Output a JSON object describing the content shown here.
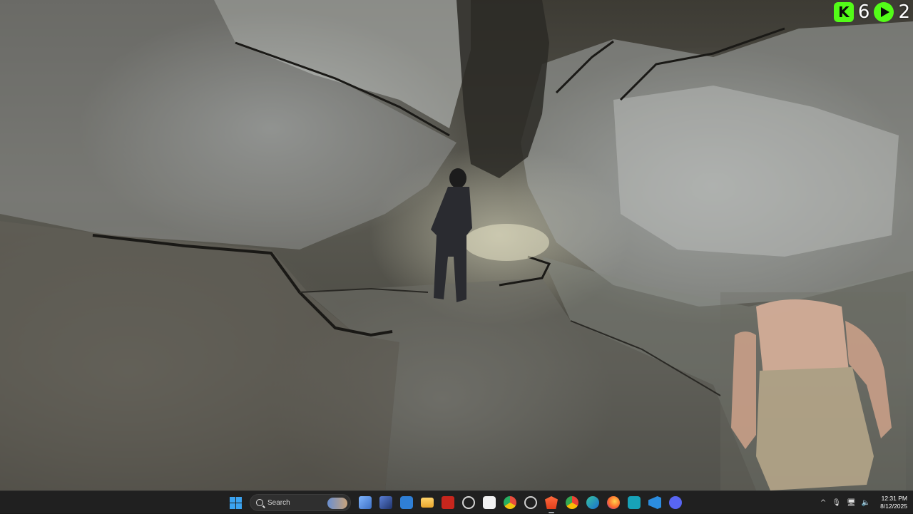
{
  "overlay": {
    "kick_count": "6",
    "kick_badge_letter": "K",
    "rumble_count": "2",
    "kick_icon": "kick-logo-icon",
    "rumble_icon": "rumble-play-icon",
    "accent_color": "#53fc18"
  },
  "taskbar": {
    "search_placeholder": "Search",
    "apps": [
      {
        "name": "start-button",
        "icon": "windows-logo-icon"
      },
      {
        "name": "search-box",
        "icon": "search-icon"
      },
      {
        "name": "app-network-tool",
        "icon": "network-tool-icon"
      },
      {
        "name": "app-media",
        "icon": "media-icon"
      },
      {
        "name": "app-remote-desktop",
        "icon": "remote-desktop-icon"
      },
      {
        "name": "app-file-explorer",
        "icon": "folder-icon"
      },
      {
        "name": "app-video-editor",
        "icon": "video-editor-icon"
      },
      {
        "name": "app-clock",
        "icon": "clock-icon"
      },
      {
        "name": "app-capcut",
        "icon": "capcut-icon"
      },
      {
        "name": "app-chrome-variant",
        "icon": "chrome-variant-icon"
      },
      {
        "name": "app-settings-alert",
        "icon": "settings-alert-icon"
      },
      {
        "name": "app-brave",
        "icon": "brave-icon"
      },
      {
        "name": "app-chrome",
        "icon": "chrome-icon"
      },
      {
        "name": "app-edge",
        "icon": "edge-icon"
      },
      {
        "name": "app-firefox",
        "icon": "firefox-icon"
      },
      {
        "name": "app-arduino",
        "icon": "infinity-icon"
      },
      {
        "name": "app-vscode",
        "icon": "vscode-icon"
      },
      {
        "name": "app-discord",
        "icon": "discord-icon"
      }
    ],
    "clock_time": "12:31 PM",
    "clock_date": "8/12/2025",
    "tray": {
      "chevron": "^",
      "mic": "🎙",
      "network": "🖥",
      "volume": "🔈"
    }
  }
}
